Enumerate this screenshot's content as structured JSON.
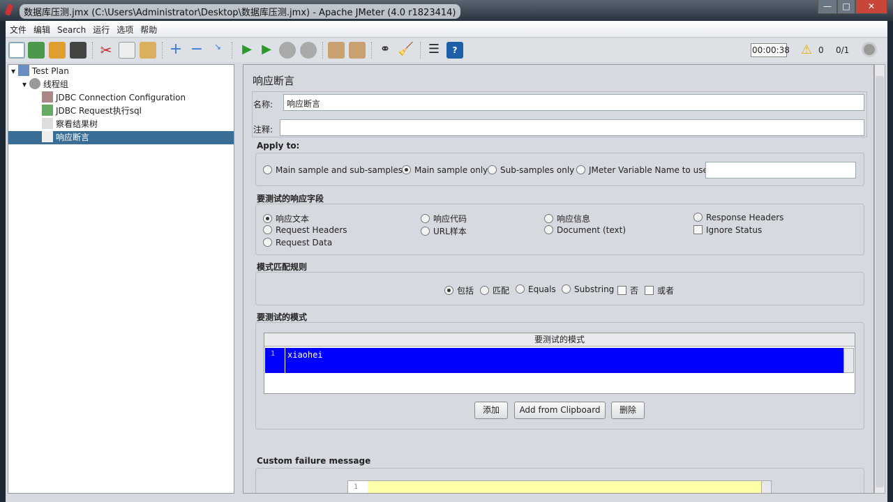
{
  "window": {
    "title": "数据库压测.jmx (C:\\Users\\Administrator\\Desktop\\数据库压测.jmx) - Apache JMeter (4.0 r1823414)",
    "min": "—",
    "max": "□",
    "close": "✕"
  },
  "menu": [
    "文件",
    "编辑",
    "Search",
    "运行",
    "选项",
    "帮助"
  ],
  "toolbar": {
    "timer": "00:00:38",
    "warnings": "0",
    "threads": "0/1"
  },
  "tree": [
    {
      "label": "Test Plan",
      "icon": "test-plan-icon"
    },
    {
      "label": "线程组",
      "icon": "gear-icon"
    },
    {
      "label": "JDBC Connection Configuration",
      "icon": "wrench-icon"
    },
    {
      "label": "JDBC Request执行sql",
      "icon": "pipette-icon"
    },
    {
      "label": "察看结果树",
      "icon": "chart-icon"
    },
    {
      "label": "响应断言",
      "icon": "assertion-icon",
      "selected": true
    }
  ],
  "panel": {
    "title": "响应断言",
    "name_label": "名称:",
    "name_value": "响应断言",
    "comment_label": "注释:",
    "comment_value": "",
    "apply_to": {
      "label": "Apply to:",
      "options": [
        "Main sample and sub-samples",
        "Main sample only",
        "Sub-samples only",
        "JMeter Variable Name to use"
      ],
      "selected": 1,
      "variable_value": ""
    },
    "field": {
      "label": "要测试的响应字段",
      "options": [
        "响应文本",
        "响应代码",
        "响应信息",
        "Response Headers",
        "Request Headers",
        "URL样本",
        "Document (text)",
        "Ignore Status",
        "Request Data"
      ],
      "selected": 0
    },
    "rules": {
      "label": "模式匹配规则",
      "options": [
        "包括",
        "匹配",
        "Equals",
        "Substring",
        "否",
        "或者"
      ],
      "selected": 0
    },
    "patterns": {
      "label": "要测试的模式",
      "column": "要测试的模式",
      "rows": [
        {
          "num": "1",
          "value": "xiaohei"
        }
      ],
      "add": "添加",
      "add_clipboard": "Add from Clipboard",
      "delete": "删除"
    },
    "failure": {
      "label": "Custom failure message",
      "line": "1",
      "value": ""
    }
  },
  "colors": {
    "selection": "#3b6e96",
    "pattern_row": "#0000ff",
    "failure_line": "#ffffa8"
  }
}
